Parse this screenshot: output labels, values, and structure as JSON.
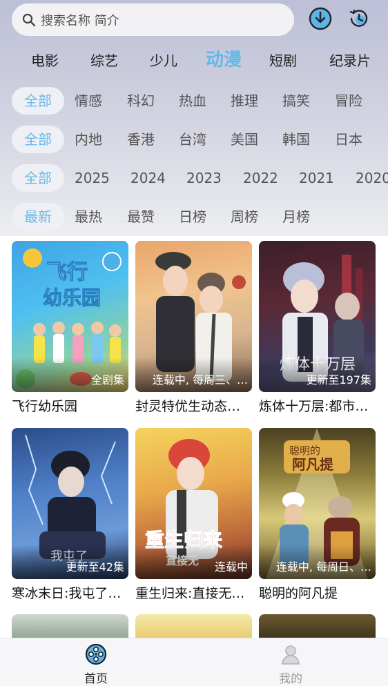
{
  "search": {
    "placeholder": "搜索名称 简介"
  },
  "main_tabs": [
    {
      "label": "电影"
    },
    {
      "label": "综艺"
    },
    {
      "label": "少儿"
    },
    {
      "label": "动漫",
      "active": true
    },
    {
      "label": "短剧"
    },
    {
      "label": "纪录片"
    }
  ],
  "filters": {
    "genre": [
      "全部",
      "情感",
      "科幻",
      "热血",
      "推理",
      "搞笑",
      "冒险",
      " "
    ],
    "region": [
      "全部",
      "内地",
      "香港",
      "台湾",
      "美国",
      "韩国",
      "日本"
    ],
    "year": [
      "全部",
      "2025",
      "2024",
      "2023",
      "2022",
      "2021",
      "2020"
    ],
    "sort": [
      "最新",
      "最热",
      "最赞",
      "日榜",
      "周榜",
      "月榜"
    ]
  },
  "cards": [
    {
      "title": "飞行幼乐园",
      "status": "全剧集"
    },
    {
      "title": "封灵特优生动态…",
      "status": "连载中, 每周三、…"
    },
    {
      "title": "炼体十万层:都市…",
      "status": "更新至197集"
    },
    {
      "title": "寒冰末日:我屯了…",
      "status": "更新至42集"
    },
    {
      "title": "重生归来:直接无…",
      "status": "连载中"
    },
    {
      "title": "聪明的阿凡提",
      "status": "连载中, 每周日、…"
    }
  ],
  "bottom_nav": [
    {
      "label": "首页",
      "active": true
    },
    {
      "label": "我的"
    }
  ],
  "colors": {
    "accent": "#64b8e8",
    "text": "#222222",
    "muted": "#9a9a9a"
  }
}
